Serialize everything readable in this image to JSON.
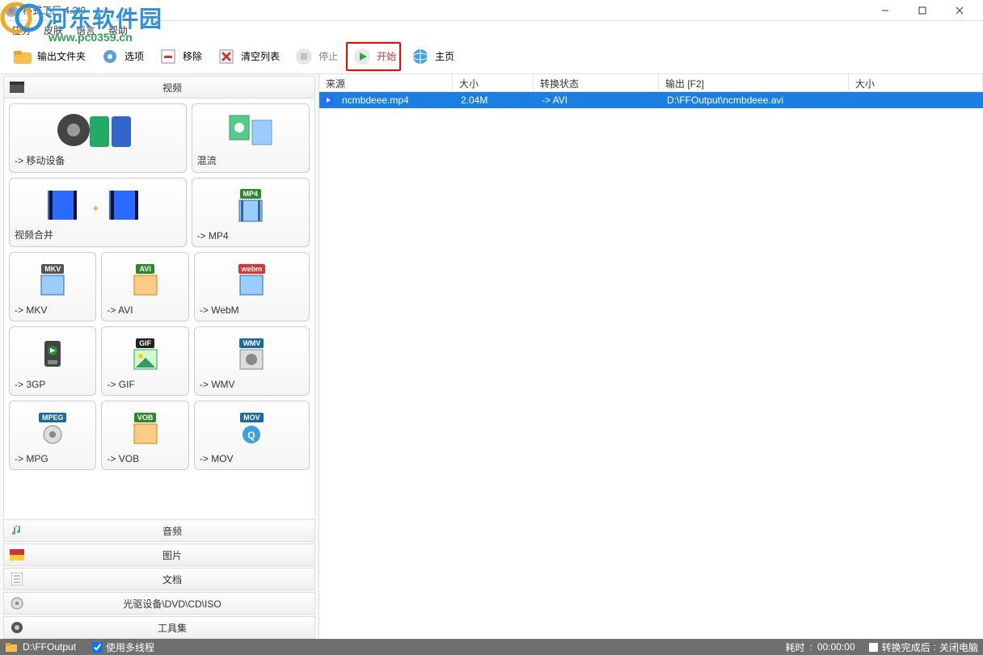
{
  "window": {
    "title": "格式工厂 4.2.0"
  },
  "menu": {
    "task": "任务",
    "skin": "皮肤",
    "language": "语言",
    "help": "帮助"
  },
  "toolbar": {
    "output_folder": "输出文件夹",
    "options": "选项",
    "remove": "移除",
    "clear_list": "清空列表",
    "stop": "停止",
    "start": "开始",
    "home": "主页"
  },
  "categories": {
    "video": "视频",
    "audio": "音频",
    "picture": "图片",
    "document": "文档",
    "disc": "光驱设备\\DVD\\CD\\ISO",
    "toolkit": "工具集"
  },
  "video_tiles": {
    "mobile": "-> 移动设备",
    "mux": "混流",
    "merge": "视频合并",
    "mp4": "-> MP4",
    "mkv": "-> MKV",
    "avi": "-> AVI",
    "webm": "-> WebM",
    "gp3": "-> 3GP",
    "gif": "-> GIF",
    "wmv": "-> WMV",
    "mpg": "-> MPG",
    "vob": "-> VOB",
    "mov": "-> MOV"
  },
  "badges": {
    "mp4": "MP4",
    "mkv": "MKV",
    "avi": "AVI",
    "webm": "webm",
    "gif": "GIF",
    "wmv": "WMV",
    "mpeg": "MPEG",
    "vob": "VOB",
    "mov": "MOV"
  },
  "list": {
    "headers": {
      "source": "来源",
      "size": "大小",
      "status": "转换状态",
      "output": "输出 [F2]",
      "size2": "大小"
    },
    "rows": [
      {
        "filename": "ncmbdeee.mp4",
        "size": "2.04M",
        "status": "-> AVI",
        "output": "D:\\FFOutput\\ncmbdeee.avi"
      }
    ]
  },
  "statusbar": {
    "output_path": "D:\\FFOutput",
    "use_multithread": "使用多线程",
    "elapsed_label": "耗时",
    "elapsed_value": "00:00:00",
    "after_convert": "转换完成后",
    "shutdown": "关闭电脑"
  },
  "watermark": {
    "site_name": "河东软件园",
    "url": "www.pc0359.cn"
  }
}
